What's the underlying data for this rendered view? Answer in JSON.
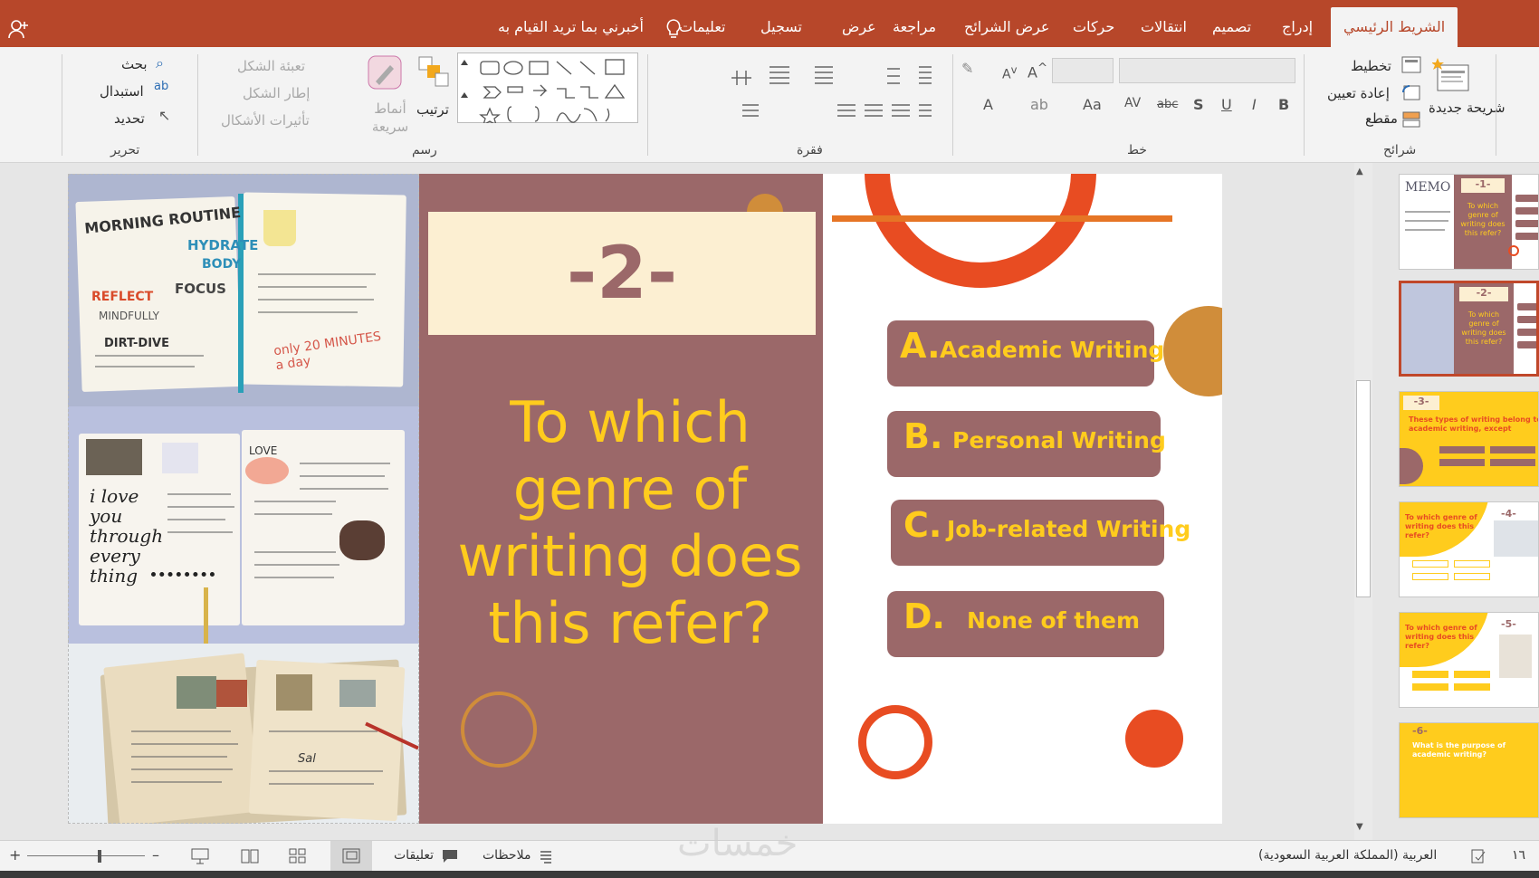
{
  "tabs": {
    "home": "الشريط الرئيسي",
    "insert": "إدراج",
    "design": "تصميم",
    "transitions": "انتقالات",
    "animations": "حركات",
    "slideshow": "عرض الشرائح",
    "review": "مراجعة",
    "view": "عرض",
    "record": "تسجيل",
    "help": "تعليمات",
    "tellme": "أخبرني بما تريد القيام به"
  },
  "ribbon": {
    "slides": {
      "new_slide": "شريحة جديدة",
      "layout": "تخطيط",
      "reset": "إعادة تعيين",
      "section": "مقطع",
      "label": "شرائح"
    },
    "font": {
      "label": "خط",
      "bold": "B",
      "italic": "I",
      "underline": "U",
      "shadow": "S",
      "strike": "abc",
      "spacing": "AV",
      "case": "Aa",
      "color": "A"
    },
    "paragraph": {
      "label": "فقرة"
    },
    "drawing": {
      "arrange": "ترتيب",
      "quick_styles": "أنماط سريعة",
      "fill": "تعبئة الشكل",
      "outline": "إطار الشكل",
      "effects": "تأثيرات الأشكال",
      "label": "رسم"
    },
    "editing": {
      "find": "بحث",
      "replace": "استبدال",
      "select": "تحديد",
      "label": "تحرير"
    }
  },
  "slide": {
    "number": "-2-",
    "question": "To which genre of writing does this refer?",
    "answers": [
      {
        "letter": "A.",
        "text": "Academic Writing"
      },
      {
        "letter": "B.",
        "text": "Personal Writing"
      },
      {
        "letter": "C.",
        "text": "Job-related Writing"
      },
      {
        "letter": "D.",
        "text": "None of them"
      }
    ],
    "photo_texts": {
      "morning": "MORNING ROUTINE",
      "hydrate": "HYDRATE",
      "body": "BODY",
      "focus": "FOCUS",
      "reflect": "REFLECT",
      "mindfully": "MINDFULLY",
      "dirt": "DIRT-DIVE",
      "only": "only 20 MINUTES a day",
      "love": "LOVE",
      "iloveyou": "i love you through every thing",
      "salud": "Sal"
    }
  },
  "thumbnails": [
    {
      "num": "-1-",
      "text": "To which genre of writing does this refer?",
      "memo": "MEMO"
    },
    {
      "num": "-2-",
      "text": "To which genre of writing does this refer?"
    },
    {
      "num": "-3-",
      "text": "These types of writing belong to academic writing, except"
    },
    {
      "num": "-4-",
      "text": "To which genre of writing does this refer?"
    },
    {
      "num": "-5-",
      "text": "To which genre of writing does this refer?"
    },
    {
      "num": "-6-",
      "text": "What is the purpose of academic writing?"
    }
  ],
  "statusbar": {
    "language": "العربية (المملكة العربية السعودية)",
    "slide_num": "١٦",
    "notes": "ملاحظات",
    "comments": "تعليقات"
  },
  "watermark": "خمسات",
  "colors": {
    "accent": "#b7472a",
    "mauve": "#9b6869",
    "yellow": "#ffcc1d",
    "orange": "#e84c22",
    "ochre": "#d08d3a"
  }
}
